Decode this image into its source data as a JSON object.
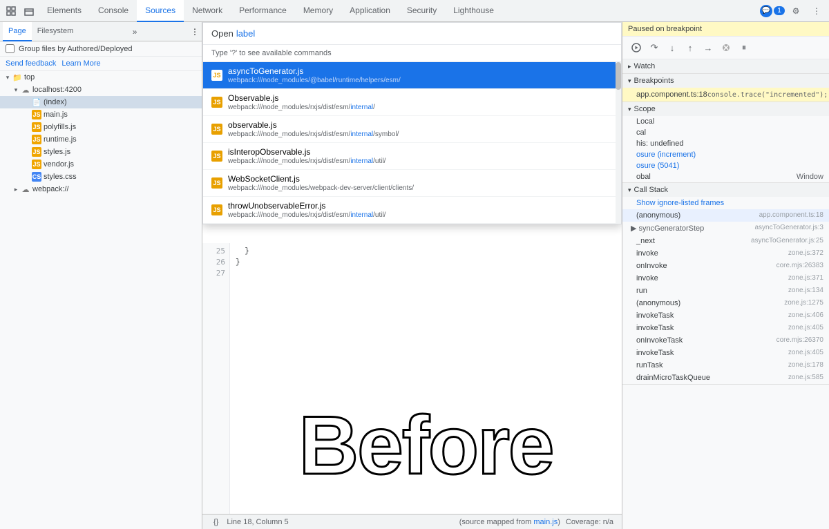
{
  "tabs": {
    "items": [
      {
        "label": "Elements",
        "active": false
      },
      {
        "label": "Console",
        "active": false
      },
      {
        "label": "Sources",
        "active": true
      },
      {
        "label": "Network",
        "active": false
      },
      {
        "label": "Performance",
        "active": false
      },
      {
        "label": "Memory",
        "active": false
      },
      {
        "label": "Application",
        "active": false
      },
      {
        "label": "Security",
        "active": false
      },
      {
        "label": "Lighthouse",
        "active": false
      }
    ],
    "badge_count": "1",
    "more_icon": "⋮",
    "settings_icon": "⚙"
  },
  "left_panel": {
    "subtabs": [
      {
        "label": "Page",
        "active": true
      },
      {
        "label": "Filesystem",
        "active": false
      }
    ],
    "group_files_label": "Group files by Authored/Deployed",
    "send_feedback": "Send feedback",
    "learn_more": "Learn More",
    "tree": [
      {
        "id": "top",
        "label": "top",
        "indent": 0,
        "type": "folder",
        "expanded": true
      },
      {
        "id": "localhost",
        "label": "localhost:4200",
        "indent": 1,
        "type": "cloud-folder",
        "expanded": true
      },
      {
        "id": "index",
        "label": "(index)",
        "indent": 2,
        "type": "file-index",
        "selected": true
      },
      {
        "id": "main",
        "label": "main.js",
        "indent": 2,
        "type": "file-js"
      },
      {
        "id": "polyfills",
        "label": "polyfills.js",
        "indent": 2,
        "type": "file-js"
      },
      {
        "id": "runtime",
        "label": "runtime.js",
        "indent": 2,
        "type": "file-js"
      },
      {
        "id": "styles_js",
        "label": "styles.js",
        "indent": 2,
        "type": "file-js"
      },
      {
        "id": "vendor",
        "label": "vendor.js",
        "indent": 2,
        "type": "file-js"
      },
      {
        "id": "styles_css",
        "label": "styles.css",
        "indent": 2,
        "type": "file-css"
      },
      {
        "id": "webpack",
        "label": "webpack://",
        "indent": 1,
        "type": "cloud-folder",
        "expanded": false
      }
    ]
  },
  "quick_open": {
    "open_label": "Open",
    "input_value": "label",
    "hint": "Type '?' to see available commands",
    "items": [
      {
        "name": "asyncToGenerator.js",
        "path": "webpack:///node_modules/@babel/runtime/helpers/esm/",
        "path_highlight_start": 45,
        "selected": true
      },
      {
        "name": "Observable.js",
        "path": "webpack:///node_modules/rxjs/dist/esm/internal/",
        "path_highlight": "internal"
      },
      {
        "name": "observable.js",
        "path": "webpack:///node_modules/rxjs/dist/esm/internal/symbol/",
        "path_highlight": "internal"
      },
      {
        "name": "isInteropObservable.js",
        "path": "webpack:///node_modules/rxjs/dist/esm/internal/util/",
        "path_highlight": "internal"
      },
      {
        "name": "WebSocketClient.js",
        "path": "webpack:///node_modules/webpack-dev-server/client/clients/",
        "path_highlight": "clients"
      },
      {
        "name": "throwUnobservableError.js",
        "path": "webpack:///node_modules/rxjs/dist/esm/internal/util/",
        "path_highlight": "internal"
      }
    ]
  },
  "code_editor": {
    "lines": [
      {
        "num": 25,
        "text": "  }"
      },
      {
        "num": 26,
        "text": "}"
      },
      {
        "num": 27,
        "text": ""
      }
    ],
    "watermark": "Before",
    "status": {
      "format_icon": "{}",
      "position": "Line 18, Column 5",
      "source_map": "(source mapped from main.js)",
      "coverage": "Coverage: n/a"
    }
  },
  "right_panel": {
    "debugger_header": "Paused on breakpoint",
    "toolbar": {
      "buttons": [
        {
          "icon": "⟳",
          "label": "resume"
        },
        {
          "icon": "↷",
          "label": "step-over"
        },
        {
          "icon": "↓",
          "label": "step-into"
        },
        {
          "icon": "↑",
          "label": "step-out"
        },
        {
          "icon": "⇥",
          "label": "step"
        },
        {
          "icon": "✕✕",
          "label": "deactivate"
        },
        {
          "icon": "⏸",
          "label": "pause-on-exception"
        }
      ]
    },
    "sections": {
      "watch": {
        "label": "Watch",
        "expanded": false
      },
      "breakpoints": {
        "label": "Breakpoints",
        "expanded": true,
        "items": [
          {
            "file": "app.component.ts:18",
            "code": "console.trace(\"incremented\");"
          }
        ]
      },
      "scope": {
        "label": "Scope",
        "expanded": true,
        "items": [
          {
            "name": "Local",
            "val": "",
            "type": "section"
          },
          {
            "name": "cal",
            "val": "",
            "expandable": false
          },
          {
            "name": "his: undefined",
            "val": "",
            "expandable": false
          },
          {
            "name": "osure (increment)",
            "val": "",
            "expandable": true
          },
          {
            "name": "osure (5041)",
            "val": "",
            "expandable": true
          },
          {
            "name": "obal",
            "val": "Window",
            "expandable": false
          }
        ]
      },
      "call_stack": {
        "label": "Call Stack",
        "expanded": true,
        "items": [
          {
            "fn": "(anonymous)",
            "loc": "app.component.ts:18",
            "active": true
          },
          {
            "fn": "▶ syncGeneratorStep",
            "loc": "",
            "expandable": true
          },
          {
            "fn": "_next",
            "loc": "asyncToGenerator.js:25"
          },
          {
            "fn": "invoke",
            "loc": "zone.js:372"
          },
          {
            "fn": "onInvoke",
            "loc": "core.mjs:26383"
          },
          {
            "fn": "invoke",
            "loc": "zone.js:371"
          },
          {
            "fn": "run",
            "loc": "zone.js:134"
          },
          {
            "fn": "(anonymous)",
            "loc": "zone.js:1275"
          },
          {
            "fn": "invokeTask",
            "loc": "zone.js:406"
          },
          {
            "fn": "invokeTask",
            "loc": "zone.js:405"
          },
          {
            "fn": "onInvokeTask",
            "loc": "core.mjs:26370"
          },
          {
            "fn": "invokeTask",
            "loc": "zone.js:405"
          },
          {
            "fn": "runTask",
            "loc": "zone.js:178"
          },
          {
            "fn": "drainMicroTaskQueue",
            "loc": "zone.js:585"
          }
        ],
        "show_ignore": "Show ignore-listed frames"
      }
    }
  }
}
